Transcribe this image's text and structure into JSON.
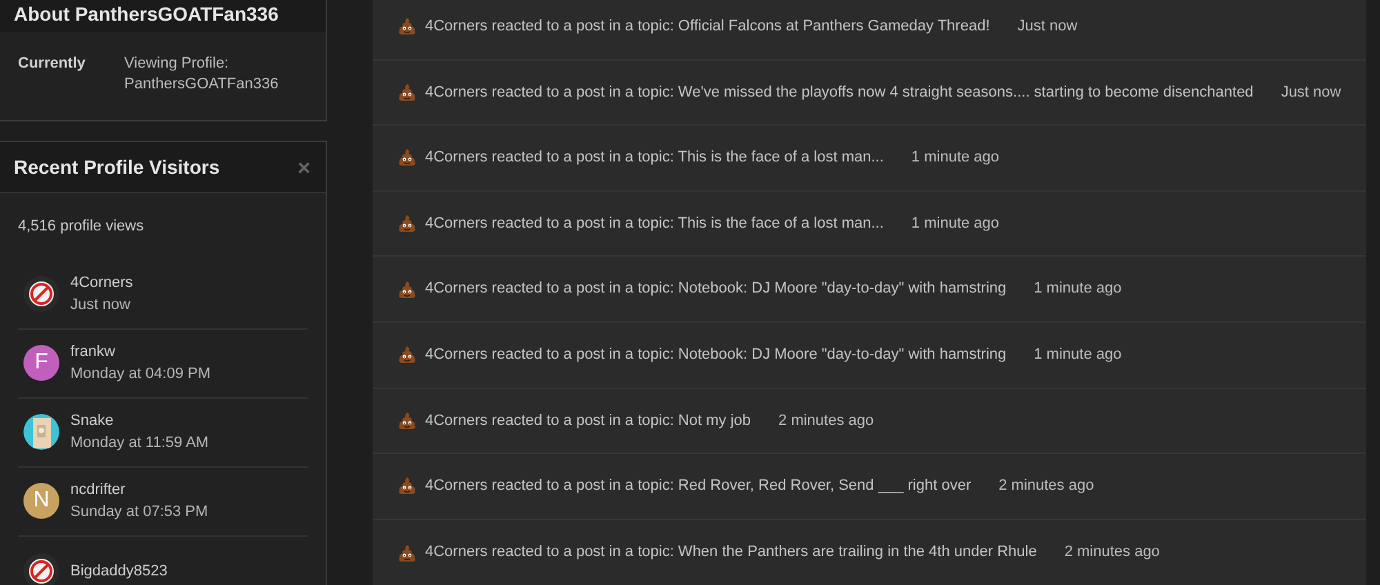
{
  "about": {
    "title": "About PanthersGOATFan336",
    "fields": [
      {
        "label": "Currently",
        "value": "Viewing Profile: PanthersGOATFan336"
      }
    ]
  },
  "visitors": {
    "title": "Recent Profile Visitors",
    "close": "×",
    "views": "4,516 profile views",
    "items": [
      {
        "name": "4Corners",
        "time": "Just now",
        "kind": "picture"
      },
      {
        "name": "frankw",
        "time": "Monday at 04:09 PM",
        "kind": "letter",
        "letter": "F",
        "color": "#c15fbd"
      },
      {
        "name": "Snake",
        "time": "Monday at 11:59 AM",
        "kind": "picture"
      },
      {
        "name": "ncdrifter",
        "time": "Sunday at 07:53 PM",
        "kind": "letter",
        "letter": "N",
        "color": "#c7a260"
      },
      {
        "name": "Bigdaddy8523",
        "kind": "picture"
      }
    ]
  },
  "activity": [
    {
      "text": "4Corners reacted to a post in a topic: Official Falcons at Panthers Gameday Thread!",
      "time": "Just now"
    },
    {
      "text": "4Corners reacted to a post in a topic: We've missed the playoffs now 4 straight seasons.... starting to become disenchanted",
      "time": "Just now"
    },
    {
      "text": "4Corners reacted to a post in a topic: This is the face of a lost man...",
      "time": "1 minute ago"
    },
    {
      "text": "4Corners reacted to a post in a topic: This is the face of a lost man...",
      "time": "1 minute ago"
    },
    {
      "text": "4Corners reacted to a post in a topic: Notebook: DJ Moore \"day-to-day\" with hamstring",
      "time": "1 minute ago"
    },
    {
      "text": "4Corners reacted to a post in a topic: Notebook: DJ Moore \"day-to-day\" with hamstring",
      "time": "1 minute ago"
    },
    {
      "text": "4Corners reacted to a post in a topic: Not my job",
      "time": "2 minutes ago"
    },
    {
      "text": "4Corners reacted to a post in a topic: Red Rover, Red Rover, Send ___ right over",
      "time": "2 minutes ago"
    },
    {
      "text": "4Corners reacted to a post in a topic: When the Panthers are trailing in the 4th under Rhule",
      "time": "2 minutes ago"
    }
  ]
}
